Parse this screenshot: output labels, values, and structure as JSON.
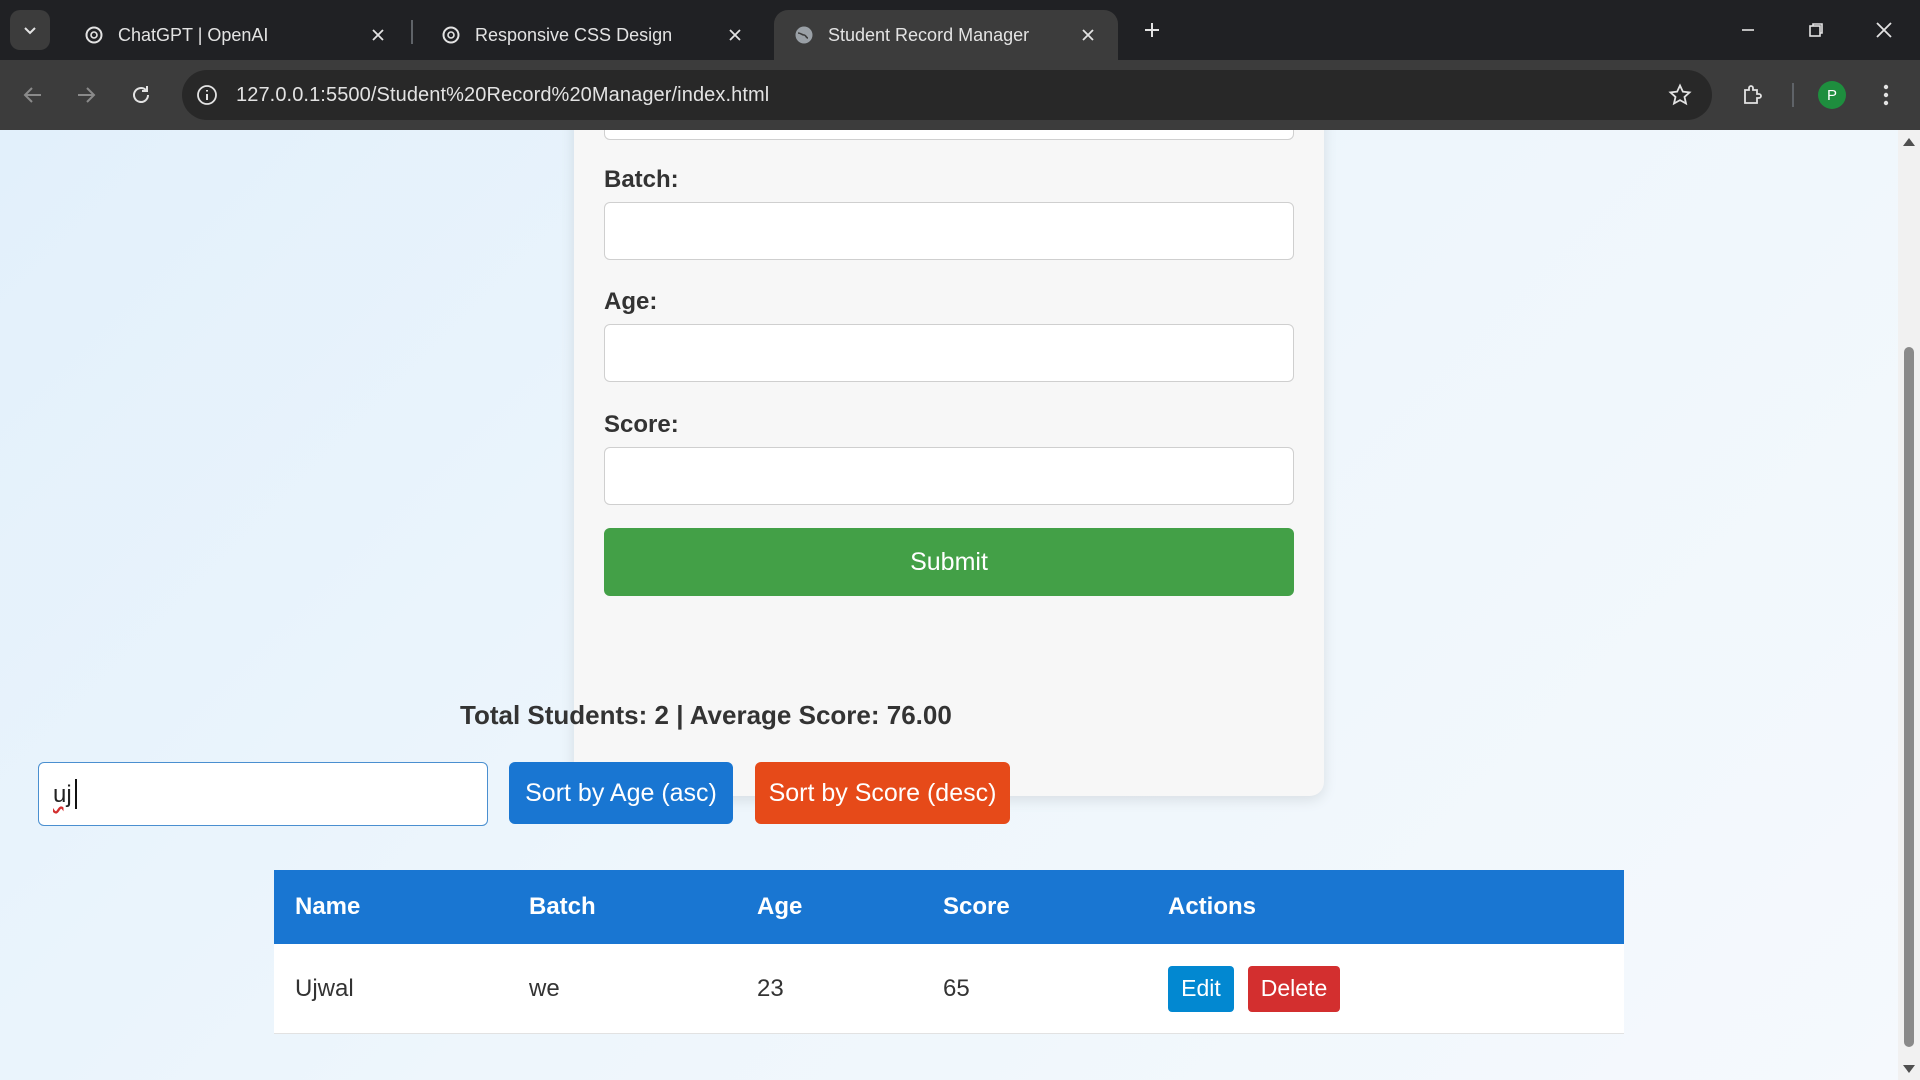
{
  "browser": {
    "tabs": [
      {
        "title": "ChatGPT | OpenAI",
        "active": false
      },
      {
        "title": "Responsive CSS Design",
        "active": false
      },
      {
        "title": "Student Record Manager",
        "active": true
      }
    ],
    "url": "127.0.0.1:5500/Student%20Record%20Manager/index.html",
    "profile_initial": "P"
  },
  "form": {
    "fields": [
      {
        "label": "Batch:",
        "value": ""
      },
      {
        "label": "Age:",
        "value": ""
      },
      {
        "label": "Score:",
        "value": ""
      }
    ],
    "submit_label": "Submit"
  },
  "summary": {
    "text": "Total Students: 2 | Average Score: 76.00"
  },
  "controls": {
    "search_value": "uj",
    "sort_age_label": "Sort by Age (asc)",
    "sort_score_label": "Sort by Score (desc)"
  },
  "table": {
    "headers": [
      "Name",
      "Batch",
      "Age",
      "Score",
      "Actions"
    ],
    "rows": [
      {
        "name": "Ujwal",
        "batch": "we",
        "age": "23",
        "score": "65"
      }
    ],
    "edit_label": "Edit",
    "delete_label": "Delete"
  },
  "colors": {
    "submit": "#43a047",
    "sort_age": "#1976d2",
    "sort_score": "#e64a19",
    "table_header": "#1976d2",
    "edit": "#0288d1",
    "delete": "#d32f2f"
  }
}
